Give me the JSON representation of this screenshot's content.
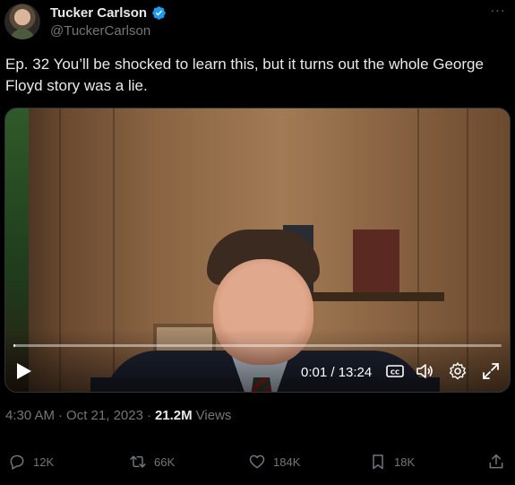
{
  "author": {
    "display_name": "Tucker Carlson",
    "handle": "@TuckerCarlson",
    "verified": true
  },
  "tweet": {
    "text": "Ep. 32  You’ll be shocked to learn this, but it turns out the whole George Floyd story was a lie.",
    "time": "4:30 AM",
    "date": "Oct 21, 2023",
    "separator": "·",
    "views_count": "21.2M",
    "views_label": "Views"
  },
  "video": {
    "time_display": "0:01 / 13:24",
    "progress": 0.001
  },
  "actions": {
    "replies": "12K",
    "reposts": "66K",
    "likes": "184K",
    "bookmarks": "18K"
  },
  "icons": {
    "verified": "verified-badge-icon",
    "more": "more-icon",
    "play": "play-icon",
    "captions": "captions-icon",
    "volume": "volume-icon",
    "settings": "settings-icon",
    "fullscreen": "fullscreen-icon",
    "reply": "reply-icon",
    "repost": "repost-icon",
    "like": "like-icon",
    "bookmark": "bookmark-icon",
    "share": "share-icon"
  },
  "colors": {
    "accent": "#1d9bf0",
    "text": "#e7e9ea",
    "muted": "#71767b"
  }
}
